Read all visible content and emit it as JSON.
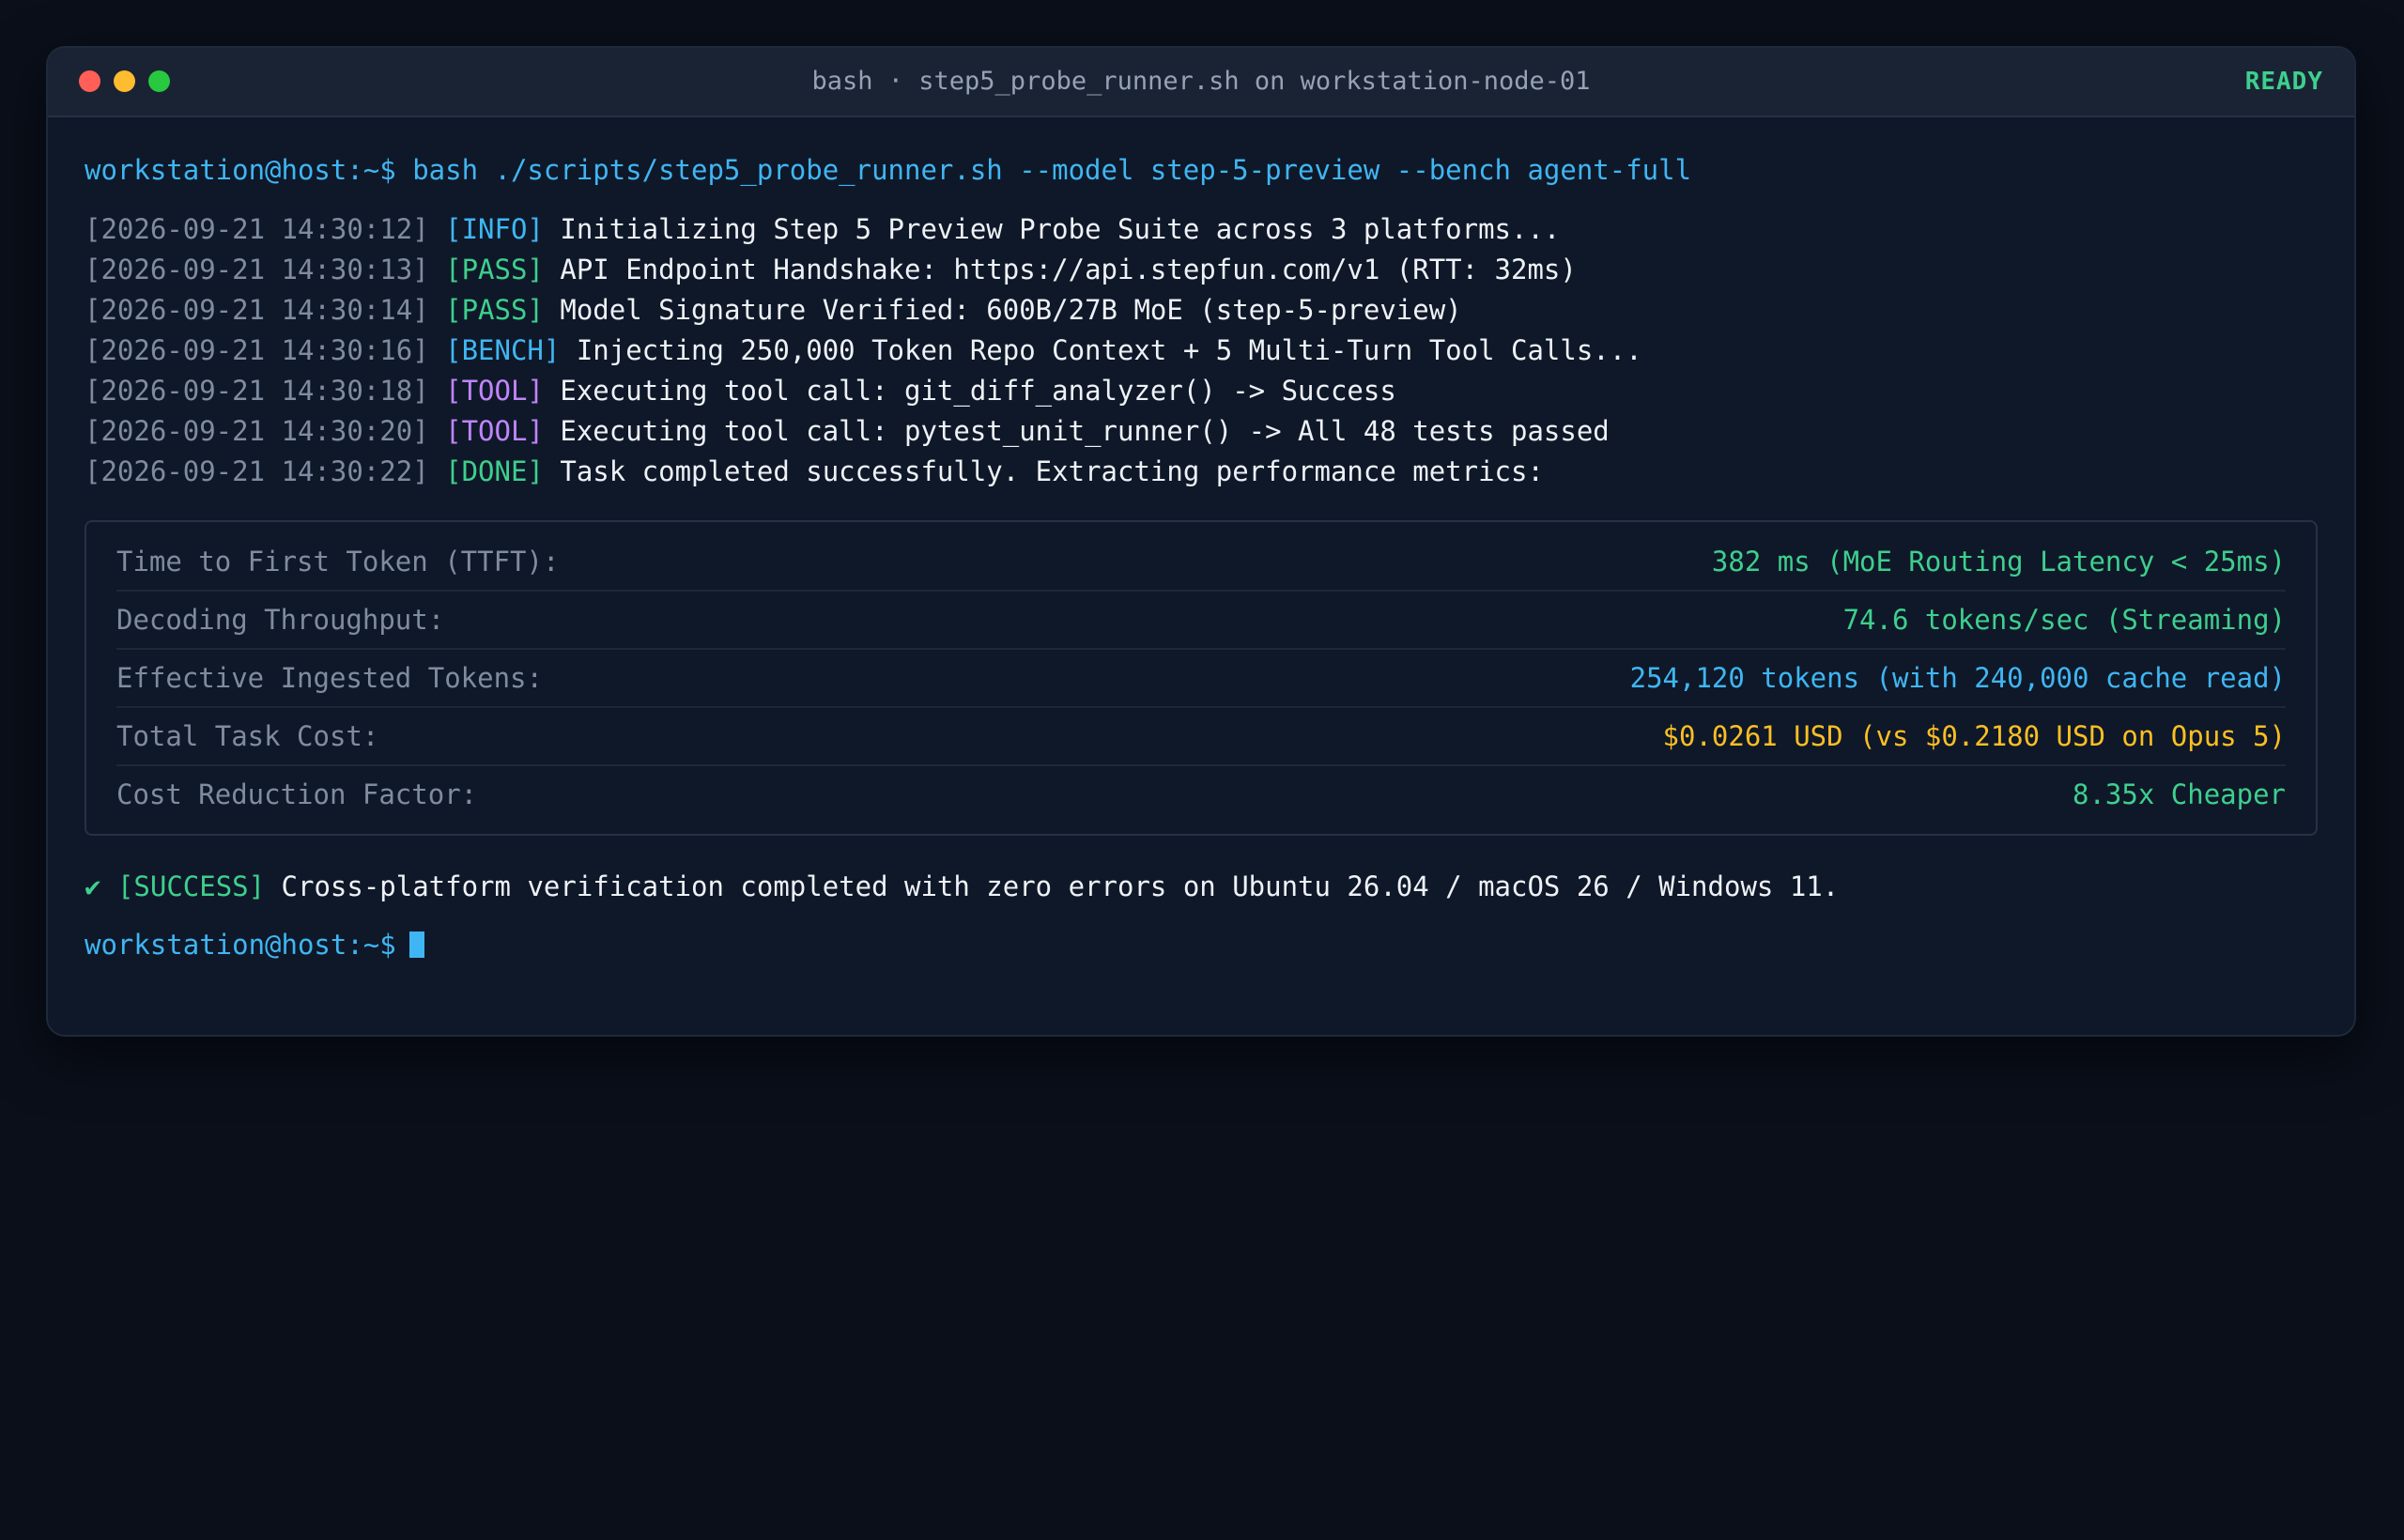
{
  "window": {
    "title": "bash · step5_probe_runner.sh on workstation-node-01",
    "status": "READY",
    "colors": {
      "close": "#ff5f57",
      "minimize": "#febc2e",
      "maximize": "#28c840",
      "accent": "#3fb6f3",
      "success": "#3ecf8e"
    }
  },
  "command": {
    "prompt": "workstation@host:~$",
    "text": "bash ./scripts/step5_probe_runner.sh --model step-5-preview --bench agent-full"
  },
  "log": [
    {
      "ts": "[2026-09-21 14:30:12]",
      "tag": "[INFO]",
      "msg": "Initializing Step 5 Preview Probe Suite across 3 platforms..."
    },
    {
      "ts": "[2026-09-21 14:30:13]",
      "tag": "[PASS]",
      "msg": "API Endpoint Handshake: https://api.stepfun.com/v1 (RTT: 32ms)"
    },
    {
      "ts": "[2026-09-21 14:30:14]",
      "tag": "[PASS]",
      "msg": "Model Signature Verified: 600B/27B MoE (step-5-preview)"
    },
    {
      "ts": "[2026-09-21 14:30:16]",
      "tag": "[BENCH]",
      "msg": "Injecting 250,000 Token Repo Context + 5 Multi-Turn Tool Calls..."
    },
    {
      "ts": "[2026-09-21 14:30:18]",
      "tag": "[TOOL]",
      "msg": "Executing tool call: git_diff_analyzer() -> Success"
    },
    {
      "ts": "[2026-09-21 14:30:20]",
      "tag": "[TOOL]",
      "msg": "Executing tool call: pytest_unit_runner() -> All 48 tests passed"
    },
    {
      "ts": "[2026-09-21 14:30:22]",
      "tag": "[DONE]",
      "msg": "Task completed successfully. Extracting performance metrics:"
    }
  ],
  "metrics": [
    {
      "label": "Time to First Token (TTFT):",
      "value": "382 ms (MoE Routing Latency < 25ms)"
    },
    {
      "label": "Decoding Throughput:",
      "value": "74.6 tokens/sec (Streaming)"
    },
    {
      "label": "Effective Ingested Tokens:",
      "value": "254,120 tokens (with 240,000 cache read)"
    },
    {
      "label": "Total Task Cost:",
      "value": "$0.0261 USD (vs $0.2180 USD on Opus 5)"
    },
    {
      "label": "Cost Reduction Factor:",
      "value": "8.35x Cheaper"
    }
  ],
  "success": {
    "check": "✔",
    "tag": "[SUCCESS]",
    "msg": "Cross-platform verification completed with zero errors on Ubuntu 26.04 / macOS 26 / Windows 11."
  },
  "final_prompt": "workstation@host:~$"
}
